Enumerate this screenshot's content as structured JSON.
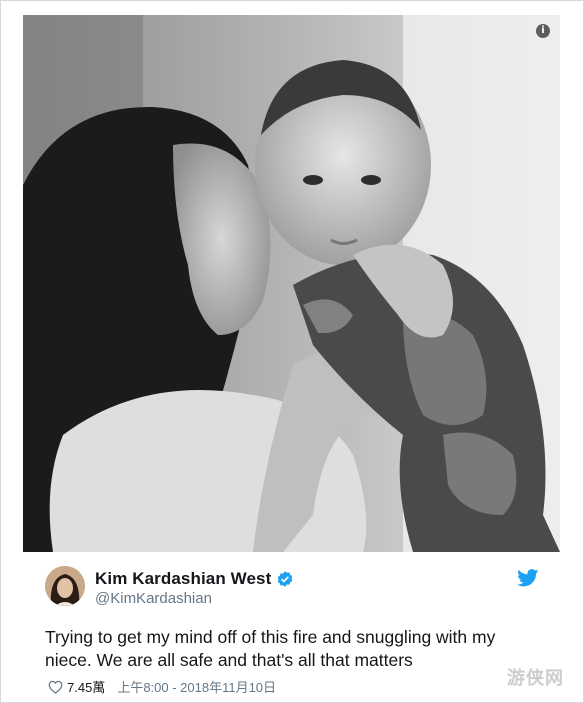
{
  "photo": {
    "alt_icon": "info-icon",
    "info_glyph": "i"
  },
  "author": {
    "name": "Kim Kardashian West",
    "handle": "@KimKardashian",
    "verified_icon": "verified-badge-icon"
  },
  "tweet": {
    "text": "Trying to get my mind off of this fire and snuggling with my niece. We are all safe and that's all that matters",
    "likes": "7.45萬",
    "timestamp": "上午8:00 - 2018年11月10日"
  },
  "brand": {
    "icon": "twitter-bird-icon",
    "color": "#1da1f2"
  },
  "watermark": {
    "text": "游侠网",
    "icon": "watermark-logo"
  }
}
